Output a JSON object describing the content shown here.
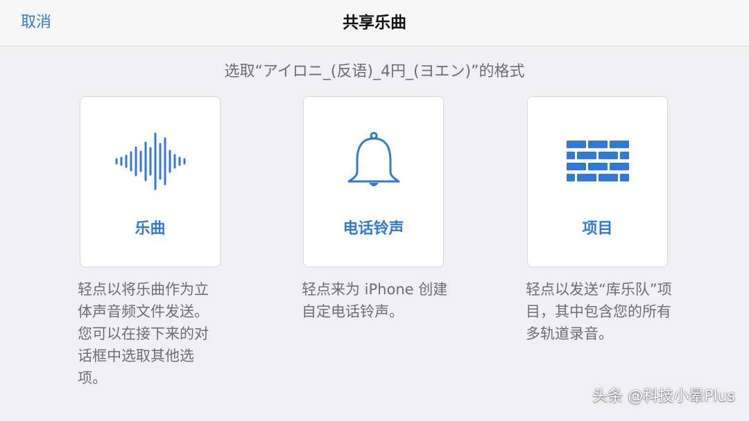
{
  "navbar": {
    "cancel_label": "取消",
    "title": "共享乐曲"
  },
  "subtitle": "选取“アイロニ_(反语)_4円_(ヨエン)”的格式",
  "options": [
    {
      "label": "乐曲",
      "icon": "waveform-icon",
      "description": "轻点以将乐曲作为立体声音频文件发送。您可以在接下来的对话框中选取其他选项。"
    },
    {
      "label": "电话铃声",
      "icon": "bell-icon",
      "description": "轻点来为 iPhone 创建自定电话铃声。"
    },
    {
      "label": "项目",
      "icon": "bricks-icon",
      "description": "轻点以发送“库乐队”项目，其中包含您的所有多轨道录音。"
    }
  ],
  "watermark": "头条 @科技小晕Plus",
  "colors": {
    "accent": "#2f7ad8",
    "background": "#efeff4",
    "card": "#ffffff",
    "secondary_text": "#6d6d72"
  }
}
